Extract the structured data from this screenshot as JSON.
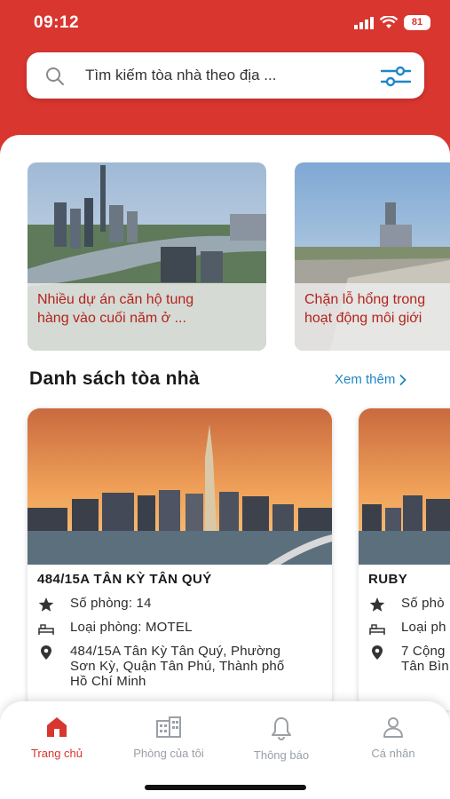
{
  "status_bar": {
    "time": "09:12",
    "battery": "81"
  },
  "search": {
    "placeholder": "Tìm kiếm tòa nhà theo địa ..."
  },
  "news": [
    {
      "title_line1": "Nhiều dự án căn hộ tung",
      "title_line2": "hàng vào cuối năm ở ..."
    },
    {
      "title_line1": "Chặn lỗ hổng trong",
      "title_line2": "hoạt động môi giới"
    }
  ],
  "buildings_section": {
    "title": "Danh sách tòa nhà",
    "see_more": "Xem thêm"
  },
  "buildings": [
    {
      "name": "484/15A TÂN KỲ TÂN QUÝ",
      "rooms": "Số phòng: 14",
      "room_type": "Loại phòng: MOTEL",
      "address_line1": "484/15A Tân Kỳ Tân Quý, Phường",
      "address_line2": "Sơn Kỳ, Quận Tân Phú, Thành phố",
      "address_line3": "Hồ Chí Minh"
    },
    {
      "name": "RUBY",
      "rooms": "Số phò",
      "room_type": "Loại ph",
      "address_line1": "7 Cộng",
      "address_line2": "Tân Bìn"
    }
  ],
  "bottom_nav": [
    {
      "label": "Trang chủ",
      "icon": "home-icon",
      "active": true
    },
    {
      "label": "Phòng của tôi",
      "icon": "building-icon",
      "active": false
    },
    {
      "label": "Thông báo",
      "icon": "bell-icon",
      "active": false
    },
    {
      "label": "Cá nhân",
      "icon": "person-icon",
      "active": false
    }
  ],
  "colors": {
    "primary_red": "#d8362f",
    "link_blue": "#1f86c7",
    "news_title": "#b2231c",
    "nav_inactive": "#9aa0a6"
  }
}
